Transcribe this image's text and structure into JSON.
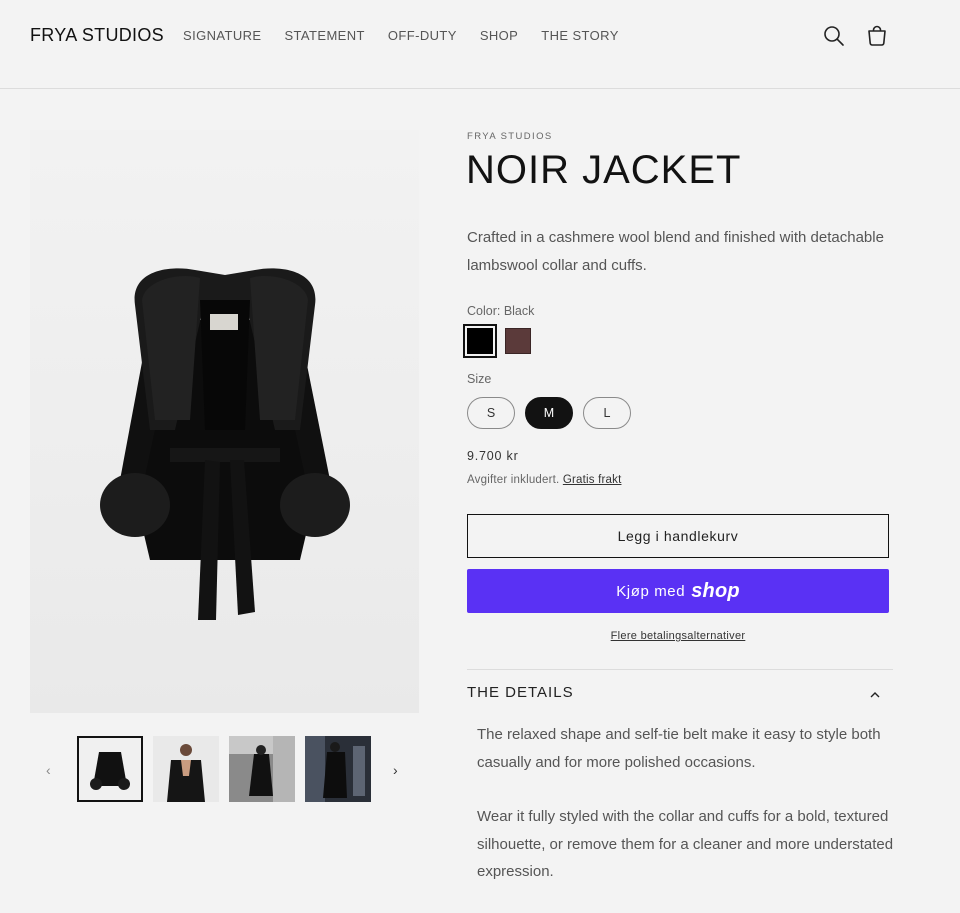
{
  "header": {
    "logo": "FRYA STUDIOS",
    "nav": [
      "SIGNATURE",
      "STATEMENT",
      "OFF-DUTY",
      "SHOP",
      "THE STORY"
    ],
    "icons": [
      "search-icon",
      "cart-icon"
    ]
  },
  "product": {
    "vendor": "FRYA STUDIOS",
    "title": "NOIR JACKET",
    "description": "Crafted in a cashmere wool blend and finished with detachable lambswool collar and cuffs.",
    "color_label": "Color: Black",
    "colors": [
      {
        "name": "Black",
        "hex": "#000000",
        "selected": true
      },
      {
        "name": "Brown",
        "hex": "#5b3a3a",
        "selected": false
      }
    ],
    "size_label": "Size",
    "sizes": [
      {
        "label": "S",
        "selected": false
      },
      {
        "label": "M",
        "selected": true
      },
      {
        "label": "L",
        "selected": false
      }
    ],
    "price": "9.700 kr",
    "tax_text": "Avgifter inkludert.",
    "shipping_link": "Gratis frakt",
    "add_to_cart": "Legg i handlekurv",
    "shop_pay_prefix": "Kjøp med",
    "shop_pay_brand": "shop",
    "more_payment": "Flere betalingsalternativer",
    "details_heading": "THE DETAILS",
    "details_paragraphs": [
      "The relaxed shape and self-tie belt make it easy to style both casually and for more polished occasions.",
      "Wear it fully styled with the collar and cuffs for a bold, textured silhouette, or remove them for a cleaner and more understated expression."
    ]
  },
  "gallery": {
    "thumbnail_count": 4,
    "selected_index": 0
  },
  "colors": {
    "shop_pay_purple": "#5a31f4",
    "text_dark": "#121212",
    "background": "#f3f3f3"
  }
}
